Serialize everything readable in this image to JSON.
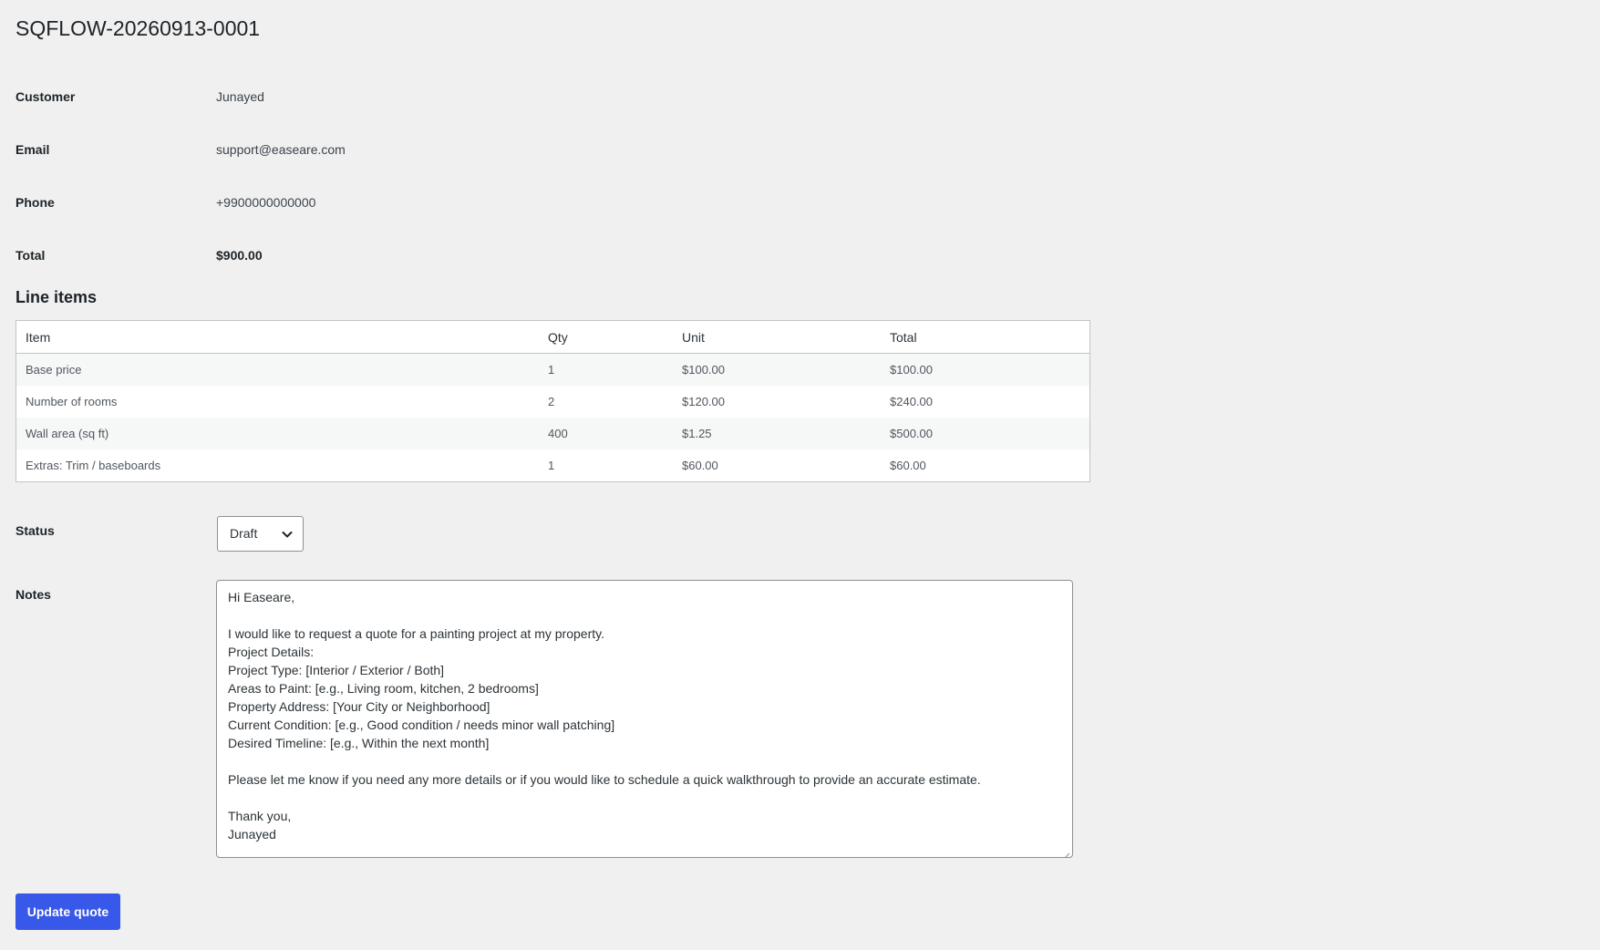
{
  "quote": {
    "title": "SQFLOW-20260913-0001"
  },
  "fields": {
    "customer": {
      "label": "Customer",
      "value": "Junayed"
    },
    "email": {
      "label": "Email",
      "value": "support@easeare.com"
    },
    "phone": {
      "label": "Phone",
      "value": "+9900000000000"
    },
    "total": {
      "label": "Total",
      "value": "$900.00"
    }
  },
  "line_items": {
    "title": "Line items",
    "headers": [
      "Item",
      "Qty",
      "Unit",
      "Total"
    ],
    "rows": [
      [
        "Base price",
        "1",
        "$100.00",
        "$100.00"
      ],
      [
        "Number of rooms",
        "2",
        "$120.00",
        "$240.00"
      ],
      [
        "Wall area (sq ft)",
        "400",
        "$1.25",
        "$500.00"
      ],
      [
        "Extras: Trim / baseboards",
        "1",
        "$60.00",
        "$60.00"
      ]
    ]
  },
  "status": {
    "label": "Status",
    "selected": "Draft"
  },
  "notes": {
    "label": "Notes",
    "lines": [
      "Hi Easeare,",
      "",
      "I would like to request a quote for a painting project at my property.",
      "Project Details:",
      "Project Type: [Interior / Exterior / Both]",
      "Areas to Paint: [e.g., Living room, kitchen, 2 bedrooms]",
      "Property Address: [Your City or Neighborhood]",
      "Current Condition: [e.g., Good condition / needs minor wall patching]",
      "Desired Timeline: [e.g., Within the next month]",
      "",
      "Please let me know if you need any more details or if you would like to schedule a quick walkthrough to provide an accurate estimate.",
      "",
      "Thank you,",
      "Junayed"
    ]
  },
  "actions": {
    "update_label": "Update quote"
  },
  "colors": {
    "background": "#f0f0f1",
    "primary_button": "#3858e9",
    "border": "#c3c4c7",
    "text": "#1d2327"
  },
  "icons": {
    "select": "chevron-down-icon",
    "textarea": "resize-grip-icon"
  }
}
